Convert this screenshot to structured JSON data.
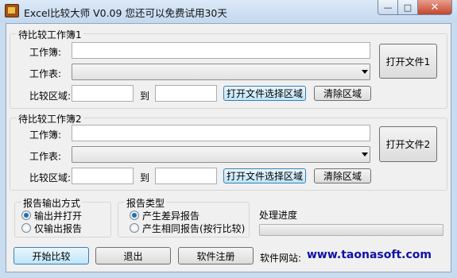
{
  "window": {
    "title": "Excel比较大师 V0.09  您还可以免费试用30天"
  },
  "titlebar_buttons": {
    "minimize": "—",
    "maximize": "□",
    "close": "✕"
  },
  "workbook1": {
    "group_label": "待比较工作簿1",
    "workbook_label": "工作簿:",
    "workbook_value": "",
    "sheet_label": "工作表:",
    "sheet_value": "",
    "range_label": "比较区域:",
    "range_from": "",
    "to_label": "到",
    "range_to": "",
    "select_range_button": "打开文件选择区域",
    "clear_range_button": "清除区域",
    "open_file_button": "打开文件1"
  },
  "workbook2": {
    "group_label": "待比较工作簿2",
    "workbook_label": "工作簿:",
    "workbook_value": "",
    "sheet_label": "工作表:",
    "sheet_value": "",
    "range_label": "比较区域:",
    "range_from": "",
    "to_label": "到",
    "range_to": "",
    "select_range_button": "打开文件选择区域",
    "clear_range_button": "清除区域",
    "open_file_button": "打开文件2"
  },
  "output_mode": {
    "label": "报告输出方式",
    "options": [
      "输出并打开",
      "仅输出报告"
    ],
    "selected": 0
  },
  "report_type": {
    "label": "报告类型",
    "options": [
      "产生差异报告",
      "产生相同报告(按行比较)"
    ],
    "selected": 0
  },
  "progress": {
    "label": "处理进度",
    "value": 0
  },
  "buttons": {
    "start": "开始比较",
    "exit": "退出",
    "register": "软件注册"
  },
  "website": {
    "label": "软件网站:",
    "url": "www.taonasoft.com"
  }
}
